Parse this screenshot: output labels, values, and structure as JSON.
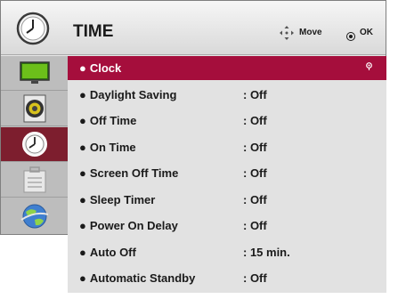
{
  "header": {
    "title": "TIME",
    "move_label": "Move",
    "ok_label": "OK"
  },
  "sidebar": {
    "items": [
      {
        "icon": "picture-icon"
      },
      {
        "icon": "sound-icon"
      },
      {
        "icon": "time-icon",
        "active": true
      },
      {
        "icon": "setup-icon"
      },
      {
        "icon": "network-icon"
      }
    ]
  },
  "menu": {
    "items": [
      {
        "label": "Clock",
        "value": "",
        "selected": true
      },
      {
        "label": "Daylight Saving",
        "value": ": Off"
      },
      {
        "label": "Off Time",
        "value": ": Off"
      },
      {
        "label": "On Time",
        "value": ": Off"
      },
      {
        "label": "Screen Off Time",
        "value": ": Off"
      },
      {
        "label": "Sleep Timer",
        "value": ": Off"
      },
      {
        "label": "Power On Delay",
        "value": ": Off"
      },
      {
        "label": "Auto Off",
        "value": ": 15 min."
      },
      {
        "label": "Automatic Standby",
        "value": ": Off"
      }
    ],
    "bullet": "●"
  },
  "colors": {
    "selected_row": "#a50e3c",
    "active_sidebar": "#7d1e2e"
  }
}
